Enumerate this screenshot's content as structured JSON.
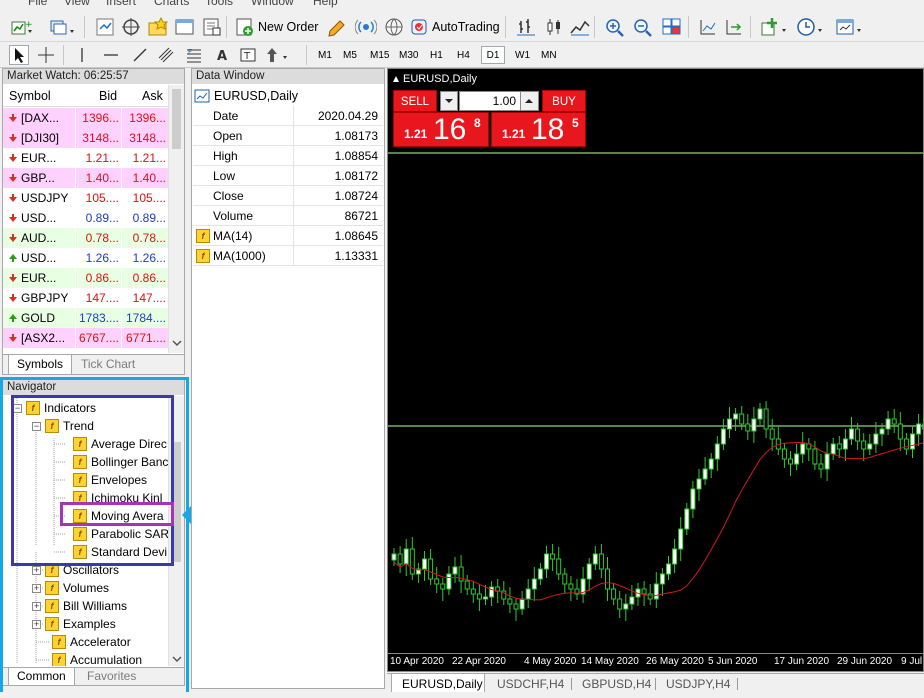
{
  "menu": [
    "File",
    "View",
    "Insert",
    "Charts",
    "Tools",
    "Window",
    "Help"
  ],
  "toolbar": {
    "new_order": "New Order",
    "autotrading": "AutoTrading",
    "timeframes": [
      "M1",
      "M5",
      "M15",
      "M30",
      "H1",
      "H4",
      "D1",
      "W1",
      "MN"
    ],
    "active_timeframe": "D1"
  },
  "market_watch": {
    "title": "Market Watch: 06:25:57",
    "columns": [
      "Symbol",
      "Bid",
      "Ask"
    ],
    "rows": [
      {
        "symbol": "[DAX...",
        "bid": "1396...",
        "ask": "1396...",
        "dir": "down",
        "bg": "pink",
        "color": "red"
      },
      {
        "symbol": "[DJI30]",
        "bid": "3148...",
        "ask": "3148...",
        "dir": "down",
        "bg": "pink",
        "color": "red"
      },
      {
        "symbol": "EUR...",
        "bid": "1.21...",
        "ask": "1.21...",
        "dir": "down",
        "bg": "white",
        "color": "red"
      },
      {
        "symbol": "GBP...",
        "bid": "1.40...",
        "ask": "1.40...",
        "dir": "down",
        "bg": "pink",
        "color": "red"
      },
      {
        "symbol": "USDJPY",
        "bid": "105....",
        "ask": "105....",
        "dir": "down",
        "bg": "white",
        "color": "red"
      },
      {
        "symbol": "USD...",
        "bid": "0.89...",
        "ask": "0.89...",
        "dir": "down",
        "bg": "white",
        "color": "blue"
      },
      {
        "symbol": "AUD...",
        "bid": "0.78...",
        "ask": "0.78...",
        "dir": "down",
        "bg": "green",
        "color": "red"
      },
      {
        "symbol": "USD...",
        "bid": "1.26...",
        "ask": "1.26...",
        "dir": "up",
        "bg": "white",
        "color": "blue"
      },
      {
        "symbol": "EUR...",
        "bid": "0.86...",
        "ask": "0.86...",
        "dir": "down",
        "bg": "green",
        "color": "red"
      },
      {
        "symbol": "GBPJPY",
        "bid": "147....",
        "ask": "147....",
        "dir": "down",
        "bg": "white",
        "color": "red"
      },
      {
        "symbol": "GOLD",
        "bid": "1783....",
        "ask": "1784....",
        "dir": "up",
        "bg": "green",
        "color": "blue"
      },
      {
        "symbol": "[ASX2...",
        "bid": "6767....",
        "ask": "6771....",
        "dir": "down",
        "bg": "pink",
        "color": "red"
      }
    ],
    "tabs": [
      "Symbols",
      "Tick Chart"
    ]
  },
  "navigator": {
    "title": "Navigator",
    "indicators": "Indicators",
    "trend": "Trend",
    "trend_items": [
      "Average Direc",
      "Bollinger Banc",
      "Envelopes",
      "Ichimoku Kinl",
      "Moving Avera",
      "Parabolic SAR",
      "Standard Devi"
    ],
    "groups": [
      "Oscillators",
      "Volumes",
      "Bill Williams",
      "Examples"
    ],
    "customs": [
      "Accelerator",
      "Accumulation"
    ],
    "tabs": [
      "Common",
      "Favorites"
    ]
  },
  "data_window": {
    "title": "Data Window",
    "symbol": "EURUSD,Daily",
    "rows": [
      {
        "label": "Date",
        "value": "2020.04.29"
      },
      {
        "label": "Open",
        "value": "1.08173"
      },
      {
        "label": "High",
        "value": "1.08854"
      },
      {
        "label": "Low",
        "value": "1.08172"
      },
      {
        "label": "Close",
        "value": "1.08724"
      },
      {
        "label": "Volume",
        "value": "86721"
      }
    ],
    "indicators": [
      {
        "label": "MA(14)",
        "value": "1.08645"
      },
      {
        "label": "MA(1000)",
        "value": "1.13331"
      }
    ]
  },
  "chart": {
    "title": "EURUSD,Daily",
    "sell_label": "SELL",
    "buy_label": "BUY",
    "lots": "1.00",
    "sell_small": "1.21",
    "sell_big": "16",
    "sell_sup": "8",
    "buy_small": "1.21",
    "buy_big": "18",
    "buy_sup": "5",
    "x_labels": [
      "10 Apr 2020",
      "22 Apr 2020",
      "4 May 2020",
      "14 May 2020",
      "26 May 2020",
      "5 Jun 2020",
      "17 Jun 2020",
      "29 Jun 2020",
      "9 Jul"
    ],
    "colors": {
      "bull": "#ffffff",
      "bear": "#000000",
      "wick": "#2ecc2e",
      "ma_fast": "#d21a1a",
      "ma_slow": "#b8ff9c"
    }
  },
  "chart_tabs": [
    "EURUSD,Daily",
    "USDCHF,H4",
    "GBPUSD,H4",
    "USDJPY,H4"
  ]
}
